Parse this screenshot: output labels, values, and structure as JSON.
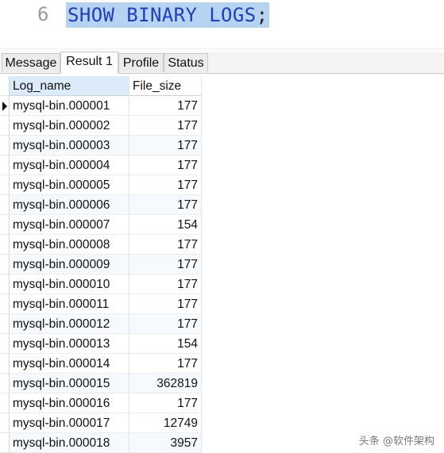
{
  "editor": {
    "line_number": "6",
    "code": "SHOW BINARY LOGS",
    "terminator": ";"
  },
  "tabs": [
    {
      "label": "Message",
      "active": false
    },
    {
      "label": "Result 1",
      "active": true
    },
    {
      "label": "Profile",
      "active": false
    },
    {
      "label": "Status",
      "active": false
    }
  ],
  "grid": {
    "columns": [
      "Log_name",
      "File_size"
    ],
    "rows": [
      [
        "mysql-bin.000001",
        "177"
      ],
      [
        "mysql-bin.000002",
        "177"
      ],
      [
        "mysql-bin.000003",
        "177"
      ],
      [
        "mysql-bin.000004",
        "177"
      ],
      [
        "mysql-bin.000005",
        "177"
      ],
      [
        "mysql-bin.000006",
        "177"
      ],
      [
        "mysql-bin.000007",
        "154"
      ],
      [
        "mysql-bin.000008",
        "177"
      ],
      [
        "mysql-bin.000009",
        "177"
      ],
      [
        "mysql-bin.000010",
        "177"
      ],
      [
        "mysql-bin.000011",
        "177"
      ],
      [
        "mysql-bin.000012",
        "177"
      ],
      [
        "mysql-bin.000013",
        "154"
      ],
      [
        "mysql-bin.000014",
        "177"
      ],
      [
        "mysql-bin.000015",
        "362819"
      ],
      [
        "mysql-bin.000016",
        "177"
      ],
      [
        "mysql-bin.000017",
        "12749"
      ],
      [
        "mysql-bin.000018",
        "3957"
      ]
    ],
    "current_row_indicator": "arrow-right-icon"
  },
  "watermark": "头条 @软件架构",
  "colors": {
    "selection_highlight": "#b7d3f2",
    "keyword_text": "#1f3fb8",
    "header_highlight": "#dcebfa"
  }
}
